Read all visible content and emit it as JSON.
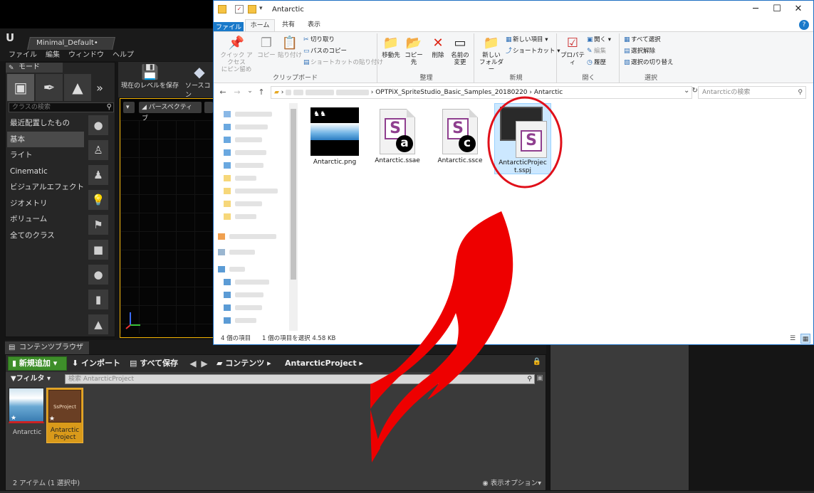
{
  "ue": {
    "doc_tab": "Minimal_Default•",
    "menu": [
      "ファイル",
      "編集",
      "ウィンドウ",
      "ヘルプ"
    ],
    "modes_tab": "モード",
    "class_search_placeholder": "クラスの検索",
    "categories": [
      "最近配置したもの",
      "基本",
      "ライト",
      "Cinematic",
      "ビジュアルエフェクト",
      "ジオメトリ",
      "ボリューム",
      "全てのクラス"
    ],
    "toolbar": {
      "save_level": "現在のレベルを保存",
      "source": "ソースコン"
    },
    "viewport": {
      "perspective": "パースペクティブ"
    },
    "content_browser": {
      "tab": "コンテンツブラウザ",
      "add_new": "新規追加",
      "import": "インポート",
      "save_all": "すべて保存",
      "crumb_root": "コンテンツ",
      "crumb_folder": "AntarcticProject",
      "filters": "フィルタ",
      "search_placeholder": "検索 AntarcticProject",
      "assets": [
        {
          "name": "Antarctic",
          "thumb_label": ""
        },
        {
          "name": "Antarctic Project",
          "thumb_label": "SsProject"
        }
      ],
      "item_count": "2 アイテム (1 選択中)",
      "view_options": "表示オプション"
    }
  },
  "explorer": {
    "title": "Antarctic",
    "tabs": [
      "ファイル",
      "ホーム",
      "共有",
      "表示"
    ],
    "ribbon": {
      "groups": [
        "クリップボード",
        "整理",
        "新規",
        "開く",
        "選択"
      ],
      "quick_access": "クイック アクセス\nにピン留め",
      "copy": "コピー",
      "paste": "貼り付け",
      "cut": "切り取り",
      "copy_path": "パスのコピー",
      "paste_shortcut": "ショートカットの貼り付け",
      "move_to": "移動先",
      "copy_to": "コピー先",
      "delete": "削除",
      "rename": "名前の\n変更",
      "new_folder": "新しい\nフォルダー",
      "new_item": "新しい項目",
      "shortcut": "ショートカット",
      "properties": "プロパティ",
      "open": "開く",
      "edit": "編集",
      "history": "履歴",
      "select_all": "すべて選択",
      "select_none": "選択解除",
      "invert_selection": "選択の切り替え"
    },
    "address": {
      "folder1": "OPTPiX_SpriteStudio_Basic_Samples_20180220",
      "folder2": "Antarctic"
    },
    "search_placeholder": "Antarcticの検索",
    "files": [
      {
        "name": "Antarctic.png",
        "type": "png"
      },
      {
        "name": "Antarctic.ssae",
        "type": "ssae",
        "badge": "a"
      },
      {
        "name": "Antarctic.ssce",
        "type": "ssce",
        "badge": "c"
      },
      {
        "name": "AntarcticProject.sspj",
        "type": "sspj"
      }
    ],
    "status": {
      "count": "4 個の項目",
      "selected": "1 個の項目を選択 4.58 KB"
    }
  },
  "colors": {
    "highlight_circle": "#e0101a",
    "arrow": "#ee0000",
    "ue_add_green": "#3e8e2a",
    "ue_selected_asset": "#d99a1a",
    "explorer_accent": "#1979ca"
  }
}
